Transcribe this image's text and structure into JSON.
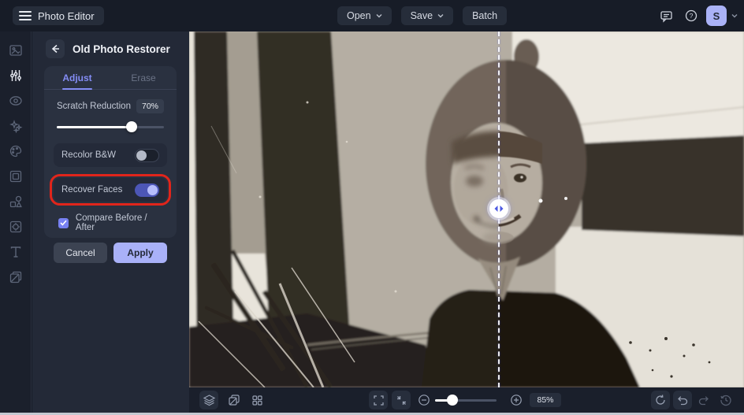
{
  "topbar": {
    "app_title": "Photo Editor",
    "open_label": "Open",
    "save_label": "Save",
    "batch_label": "Batch",
    "help_glyph": "?",
    "avatar_initial": "S"
  },
  "sidebar": {
    "items": [
      "image-icon",
      "adjustments-icon",
      "eye-icon",
      "ai-sparkles-icon",
      "palette-icon",
      "frame-icon",
      "shapes-icon",
      "effects-icon",
      "text-icon",
      "collage-icon"
    ],
    "active_index": 1
  },
  "panel": {
    "title": "Old Photo Restorer",
    "tabs": {
      "adjust": "Adjust",
      "erase": "Erase",
      "active": "Adjust"
    },
    "scratch": {
      "label": "Scratch Reduction",
      "value": "70%",
      "fill": "70%"
    },
    "recolor": {
      "label": "Recolor B&W",
      "state": "off"
    },
    "recover": {
      "label": "Recover Faces",
      "state": "on",
      "annotated": true
    },
    "compare": {
      "label": "Compare Before / After",
      "checked": true
    },
    "buttons": {
      "cancel": "Cancel",
      "apply": "Apply"
    }
  },
  "toolbar": {
    "zoom_value": "85%",
    "zoom_fill": "28%"
  },
  "colors": {
    "accent": "#848df5",
    "accent_light": "#a9b1f8",
    "toggle_on": "#4c56b6",
    "annotation_red": "#e1251b",
    "topbar_bg": "#171c27",
    "panel_bg": "#232937",
    "card_bg": "#2a3140"
  }
}
